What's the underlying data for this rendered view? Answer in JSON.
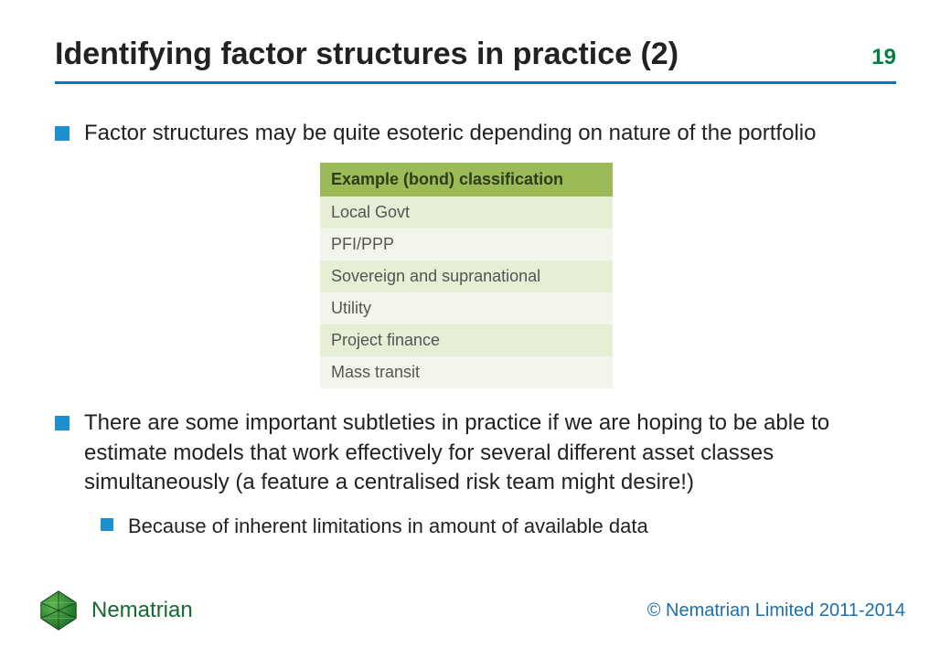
{
  "header": {
    "title": "Identifying factor structures in practice (2)",
    "page_number": "19"
  },
  "bullets": {
    "b1": "Factor structures may be quite esoteric depending on nature of the portfolio",
    "b2": "There are some important subtleties in practice if we are hoping to be able to estimate models that work effectively for several different asset classes simultaneously (a feature a centralised risk team might desire!)",
    "b2_sub1": "Because of inherent limitations in amount of available data"
  },
  "table": {
    "header": "Example (bond) classification",
    "rows": [
      "Local Govt",
      "PFI/PPP",
      "Sovereign and supranational",
      "Utility",
      "Project finance",
      "Mass transit"
    ]
  },
  "footer": {
    "brand": "Nematrian",
    "copyright": "© Nematrian Limited 2011-2014"
  },
  "colors": {
    "accent_blue": "#0078c8",
    "page_green": "#008040",
    "bullet_blue": "#1f8fd0",
    "table_header_bg": "#9bbb59"
  }
}
